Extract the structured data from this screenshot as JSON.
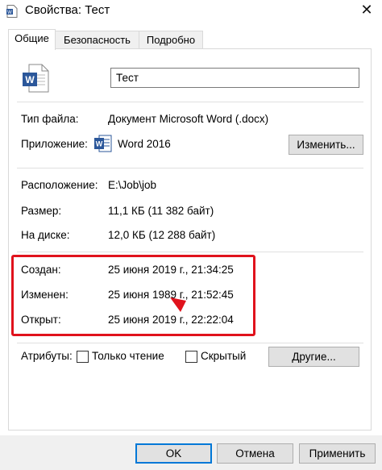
{
  "window": {
    "title": "Свойства: Тест",
    "close_glyph": "✕"
  },
  "tabs": [
    {
      "label": "Общие"
    },
    {
      "label": "Безопасность"
    },
    {
      "label": "Подробно"
    }
  ],
  "file": {
    "name_value": "Тест",
    "icon": "word-document-icon",
    "accent": "#2b579a"
  },
  "info": {
    "type_label": "Тип файла:",
    "type_value": "Документ Microsoft Word (.docx)",
    "app_label": "Приложение:",
    "app_value": "Word 2016",
    "change_button": "Изменить...",
    "location_label": "Расположение:",
    "location_value": "E:\\Job\\job",
    "size_label": "Размер:",
    "size_value": "11,1 КБ (11 382 байт)",
    "disk_label": "На диске:",
    "disk_value": "12,0 КБ (12 288 байт)"
  },
  "dates": {
    "created_label": "Создан:",
    "created_value": "25 июня 2019 г., 21:34:25",
    "modified_label": "Изменен:",
    "modified_value": "25 июня 1989 г., 21:52:45",
    "accessed_label": "Открыт:",
    "accessed_value": "25 июня 2019 г., 22:22:04",
    "highlight_color": "#e0121c"
  },
  "attributes": {
    "label": "Атрибуты:",
    "readonly_label": "Только чтение",
    "hidden_label": "Скрытый",
    "other_button": "Другие..."
  },
  "footer": {
    "ok": "OK",
    "cancel": "Отмена",
    "apply": "Применить"
  }
}
